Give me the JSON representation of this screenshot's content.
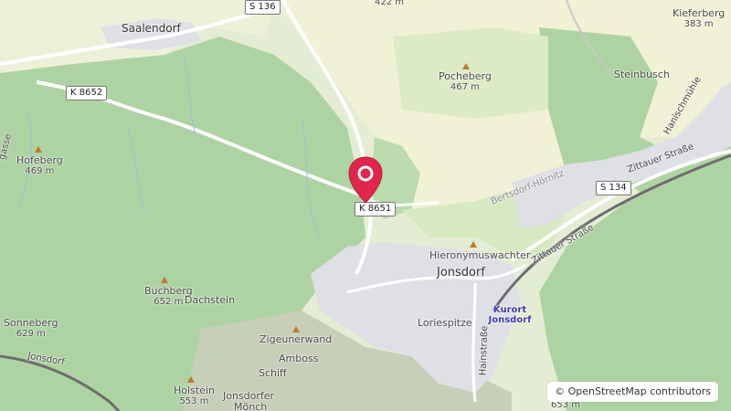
{
  "map": {
    "places": [
      {
        "name": "Saalendorf"
      },
      {
        "name": "Jonsdorf"
      },
      {
        "name": "Kurort Jonsdorf"
      }
    ],
    "peaks": [
      {
        "name": "Hofeberg",
        "elevation": "469 m"
      },
      {
        "name": "Pocheberg",
        "elevation": "467 m"
      },
      {
        "name": "Kieferberg",
        "elevation": "383 m"
      },
      {
        "name": "Buchberg",
        "elevation": "652 m"
      },
      {
        "name": "Sonneberg",
        "elevation": "629 m"
      },
      {
        "name": "Holstein",
        "elevation": "553 m"
      },
      {
        "name": "",
        "elevation": "422 m"
      },
      {
        "name": "",
        "elevation": "653 m"
      }
    ],
    "features": [
      "Steinbusch",
      "Dachstein",
      "Hieronymuswachter",
      "Loriespitze",
      "Zigeunerwand",
      "Amboss",
      "Schiff",
      "Jonsdorfer",
      "Mönch",
      "Bertsdorf-Hörnitz",
      "Hanischmühle"
    ],
    "streets": [
      "Zittauer Straße",
      "Zittauer Straße",
      "Hainstraße",
      "gasse",
      "Jonsdorf"
    ],
    "roads": [
      "S 136",
      "K 8652",
      "K 8651",
      "S 134"
    ],
    "attribution": "© OpenStreetMap contributors",
    "colors": {
      "forest": "#aed3a2",
      "farmland": "#f1f1d6",
      "meadow": "#d7e9c2",
      "urban": "#dfdfe6",
      "road": "#ffffff",
      "railway": "#6d6d6d",
      "pin": "#e0264b",
      "peak": "#c3772e",
      "station": "#3b3bb0"
    }
  }
}
